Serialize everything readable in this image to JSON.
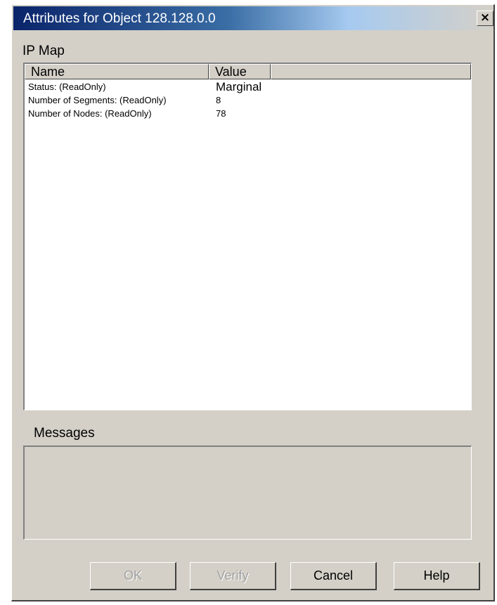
{
  "window": {
    "title": "Attributes for Object 128.128.0.0",
    "close_glyph": "×"
  },
  "ip_map": {
    "label": "IP Map",
    "columns": {
      "name": "Name",
      "value": "Value"
    },
    "rows": [
      {
        "name": "Status: (ReadOnly)",
        "value": "Marginal"
      },
      {
        "name": "Number of Segments: (ReadOnly)",
        "value": "8"
      },
      {
        "name": "Number of Nodes: (ReadOnly)",
        "value": "78"
      }
    ]
  },
  "messages": {
    "label": "Messages"
  },
  "buttons": {
    "ok": "OK",
    "verify": "Verify",
    "cancel": "Cancel",
    "help": "Help"
  }
}
